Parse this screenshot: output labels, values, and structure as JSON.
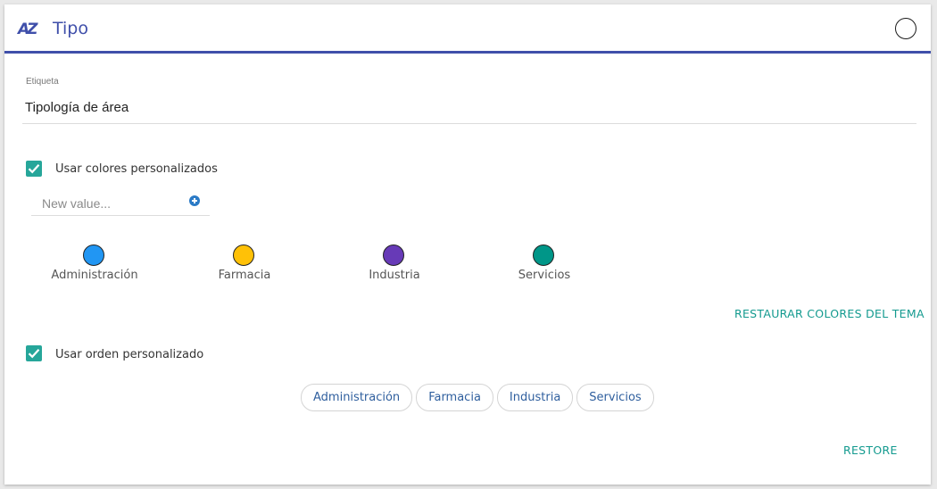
{
  "header": {
    "icon": "az-icon",
    "title": "Tipo"
  },
  "field": {
    "label": "Etiqueta",
    "value": "Tipología de área"
  },
  "custom_colors": {
    "checked": true,
    "label": "Usar colores personalizados",
    "new_value_placeholder": "New value...",
    "add_icon": "plus-circle-icon",
    "items": [
      {
        "label": "Administración",
        "color": "#2196f3"
      },
      {
        "label": "Farmacia",
        "color": "#ffc107"
      },
      {
        "label": "Industria",
        "color": "#673ab7"
      },
      {
        "label": "Servicios",
        "color": "#009688"
      }
    ],
    "restore_label": "RESTAURAR COLORES DEL TEMA"
  },
  "custom_order": {
    "checked": true,
    "label": "Usar orden personalizado",
    "items": [
      "Administración",
      "Farmacia",
      "Industria",
      "Servicios"
    ]
  },
  "footer": {
    "restore_label": "RESTORE"
  },
  "colors": {
    "accent": "#3f4faa",
    "checkbox": "#26a69a",
    "text_button": "#139a8f",
    "chip_text": "#2f5f9e"
  }
}
